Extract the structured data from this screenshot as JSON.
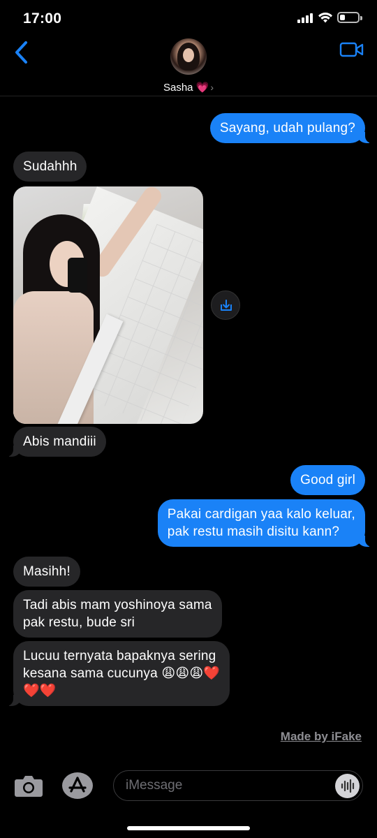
{
  "status_bar": {
    "time": "17:00"
  },
  "header": {
    "contact_name": "Sasha 💗",
    "chevron": "›"
  },
  "messages": [
    {
      "from": "me",
      "text": "Sayang, udah pulang?"
    },
    {
      "from": "them",
      "text": "Sudahhh"
    },
    {
      "from": "them",
      "type": "photo"
    },
    {
      "from": "them",
      "text": "Abis mandiii"
    },
    {
      "from": "me",
      "text": "Good girl"
    },
    {
      "from": "me",
      "line1": "Pakai cardigan yaa kalo keluar,",
      "line2": "pak restu masih disitu kann?"
    },
    {
      "from": "them",
      "text": "Masihh!"
    },
    {
      "from": "them",
      "line1": "Tadi abis mam yoshinoya sama",
      "line2": "pak restu, bude sri"
    },
    {
      "from": "them",
      "line1": "Lucuu ternyata bapaknya sering",
      "line2": "kesana sama cucunya 😩😩😩❤️",
      "line3": "❤️❤️"
    }
  ],
  "watermark": "Made by iFake",
  "composer": {
    "placeholder": "iMessage"
  },
  "colors": {
    "outgoing": "#1a82f7",
    "incoming": "#262628",
    "accent": "#1a82f7"
  },
  "icons": [
    "back-chevron-icon",
    "video-call-icon",
    "camera-icon",
    "app-store-icon",
    "audio-waveform-icon",
    "download-icon"
  ]
}
